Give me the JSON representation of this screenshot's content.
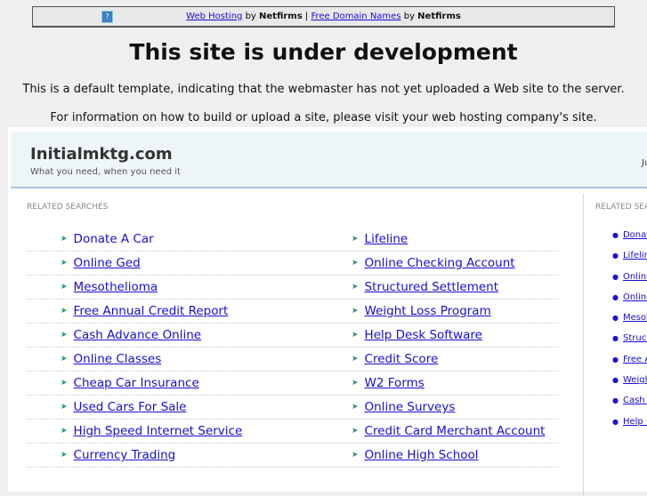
{
  "topbar": {
    "link1": "Web Hosting",
    "by1": "by",
    "brand1": "Netfirms",
    "sep": "|",
    "link2": "Free Domain Names",
    "by2": "by",
    "brand2": "Netfirms",
    "icon": "?"
  },
  "title": "This site is under development",
  "msg1": "This is a default template, indicating that the webmaster has not yet uploaded a Web site to the server.",
  "msg2": "For information on how to build or upload a site, please visit your web hosting company's site.",
  "site": {
    "name": "Initialmktg.com",
    "tagline": "What you need, when you need it",
    "right_text": "Ju"
  },
  "related_label": "RELATED SEARCHES",
  "side_label": "RELATED SEARCHES",
  "links": [
    [
      "Donate A Car",
      "Lifeline"
    ],
    [
      "Online Ged",
      "Online Checking Account"
    ],
    [
      "Mesothelioma",
      "Structured Settlement"
    ],
    [
      "Free Annual Credit Report",
      "Weight Loss Program"
    ],
    [
      "Cash Advance Online",
      "Help Desk Software"
    ],
    [
      "Online Classes",
      "Credit Score"
    ],
    [
      "Cheap Car Insurance",
      "W2 Forms"
    ],
    [
      "Used Cars For Sale",
      "Online Surveys"
    ],
    [
      "High Speed Internet Service",
      "Credit Card Merchant Account"
    ],
    [
      "Currency Trading",
      "Online High School"
    ]
  ],
  "side_links": [
    "Donate A Car",
    "Lifeline",
    "Online Ged",
    "Online Checking Account",
    "Mesothelioma",
    "Structured Settlement",
    "Free Annual Credit Report",
    "Weight Loss Program",
    "Cash Advance Online",
    "Help Desk Software"
  ]
}
